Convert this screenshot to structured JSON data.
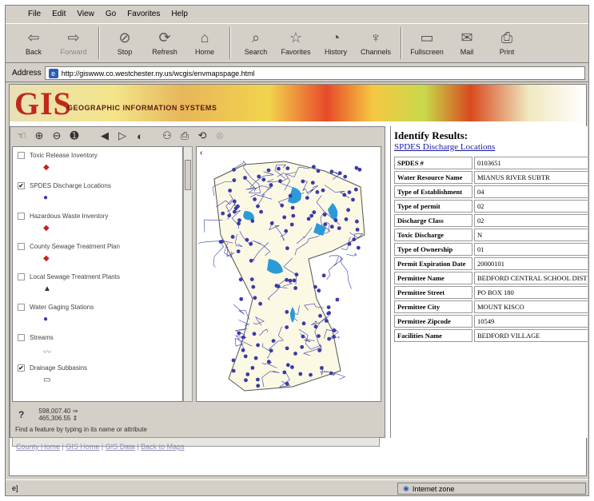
{
  "menu": [
    "File",
    "Edit",
    "View",
    "Go",
    "Favorites",
    "Help"
  ],
  "toolbar": [
    {
      "label": "Back",
      "icon": "back-arrow-icon",
      "glyph": "⇦"
    },
    {
      "label": "Forward",
      "icon": "forward-arrow-icon",
      "glyph": "⇨"
    },
    {
      "label": "Stop",
      "icon": "stop-icon",
      "glyph": "⊘"
    },
    {
      "label": "Refresh",
      "icon": "refresh-icon",
      "glyph": "⟳"
    },
    {
      "label": "Home",
      "icon": "home-icon",
      "glyph": "⌂"
    },
    {
      "label": "Search",
      "icon": "search-icon",
      "glyph": "⌕"
    },
    {
      "label": "Favorites",
      "icon": "favorites-icon",
      "glyph": "☆"
    },
    {
      "label": "History",
      "icon": "history-icon",
      "glyph": "◔"
    },
    {
      "label": "Channels",
      "icon": "channels-icon",
      "glyph": "♆"
    },
    {
      "label": "Fullscreen",
      "icon": "fullscreen-icon",
      "glyph": "▭"
    },
    {
      "label": "Mail",
      "icon": "mail-icon",
      "glyph": "✉"
    },
    {
      "label": "Print",
      "icon": "print-icon",
      "glyph": "⎙"
    }
  ],
  "address": {
    "label": "Address",
    "url": "http://giswww.co.westchester.ny.us/wcgis/envmapspage.html"
  },
  "banner": {
    "title": "GIS",
    "subtitle": "GEOGRAPHIC INFORMATION SYSTEMS"
  },
  "layers": [
    {
      "name": "Toxic Release Inventory",
      "checked": false,
      "symbol": "◆",
      "color": "#c0281c"
    },
    {
      "name": "SPDES Discharge Locations",
      "checked": true,
      "symbol": "●",
      "color": "#3a3aa8"
    },
    {
      "name": "Hazardous Waste Inventory",
      "checked": false,
      "symbol": "◆",
      "color": "#c0281c"
    },
    {
      "name": "County Sewage Treatment Plan",
      "checked": false,
      "symbol": "◆",
      "color": "#c0281c"
    },
    {
      "name": "Local Sewage Treatment Plants",
      "checked": false,
      "symbol": "▲",
      "color": "#333"
    },
    {
      "name": "Water Gaging Stations",
      "checked": false,
      "symbol": "●",
      "color": "#3a3aa8"
    },
    {
      "name": "Streams",
      "checked": false,
      "symbol": "〰",
      "color": "#6a8ad8"
    },
    {
      "name": "Drainage Subbasins",
      "checked": true,
      "symbol": "▭",
      "color": "#333"
    }
  ],
  "coords": {
    "x": "598,007.40 ⇒",
    "y": "465,306.55 ⇕"
  },
  "find_hint": "Find a feature by typing in its name or attribute",
  "results": {
    "title": "Identify Results:",
    "layer_link": "SPDES Discharge Locations",
    "rows": [
      {
        "key": "SPDES #",
        "value": "0103651"
      },
      {
        "key": "Water Resource Name",
        "value": "MIANUS RIVER SUBTR"
      },
      {
        "key": "Type of Establishment",
        "value": "04"
      },
      {
        "key": "Type of permit",
        "value": "02"
      },
      {
        "key": "Discharge Class",
        "value": "02"
      },
      {
        "key": "Toxic Discharge",
        "value": "N"
      },
      {
        "key": "Type of Ownership",
        "value": "01"
      },
      {
        "key": "Permit Expiration Date",
        "value": "20000101"
      },
      {
        "key": "Permittee Name",
        "value": "BEDFORD CENTRAL SCHOOL DIST"
      },
      {
        "key": "Permittee Street",
        "value": "PO BOX 180"
      },
      {
        "key": "Permittee City",
        "value": "MOUNT KISCO"
      },
      {
        "key": "Permittee Zipcode",
        "value": "10549"
      },
      {
        "key": "Facilities Name",
        "value": "BEDFORD VILLAGE"
      }
    ]
  },
  "footer_links": [
    "County Home",
    "GIS Home",
    "GIS Data",
    "Back to Maps"
  ],
  "status": {
    "zone": "Internet zone"
  },
  "colors": {
    "points": "#3a3aa8",
    "water": "#2a9ad8",
    "county_fill": "#fbf8e4"
  }
}
